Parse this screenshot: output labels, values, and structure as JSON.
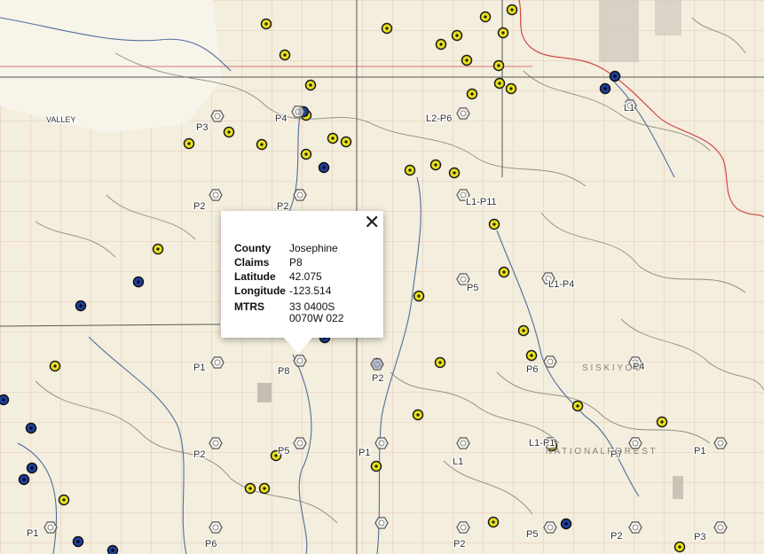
{
  "map": {
    "background": "#f4efe0",
    "yellow_marker_color": "#e8e01a",
    "blue_marker_color": "#1f3f9e",
    "labels": [
      {
        "text": "VALLEY"
      },
      {
        "text": "P3"
      },
      {
        "text": "P4"
      },
      {
        "text": "L2-P6"
      },
      {
        "text": "L1"
      },
      {
        "text": "P2"
      },
      {
        "text": "P2"
      },
      {
        "text": "L1-P11"
      },
      {
        "text": "P5"
      },
      {
        "text": "L1-P4"
      },
      {
        "text": "P1"
      },
      {
        "text": "P8"
      },
      {
        "text": "P2"
      },
      {
        "text": "P6"
      },
      {
        "text": "P4"
      },
      {
        "text": "P2"
      },
      {
        "text": "P5"
      },
      {
        "text": "P1"
      },
      {
        "text": "L1"
      },
      {
        "text": "L1-P1"
      },
      {
        "text": "P7"
      },
      {
        "text": "P1"
      },
      {
        "text": "P1"
      },
      {
        "text": "P6"
      },
      {
        "text": "P2"
      },
      {
        "text": "P5"
      },
      {
        "text": "P2"
      },
      {
        "text": "P3"
      },
      {
        "text": "S I S K I Y O U"
      },
      {
        "text": "N A T I O N A L   F O R E S T"
      }
    ]
  },
  "popup": {
    "close_label": "✕",
    "rows": [
      {
        "key": "County",
        "value": "Josephine"
      },
      {
        "key": "Claims",
        "value": "P8"
      },
      {
        "key": "Latitude",
        "value": "42.075"
      },
      {
        "key": "Longitude",
        "value": "-123.514"
      },
      {
        "key": "MTRS",
        "value": "33 0400S",
        "value2": "0070W 022"
      }
    ]
  }
}
